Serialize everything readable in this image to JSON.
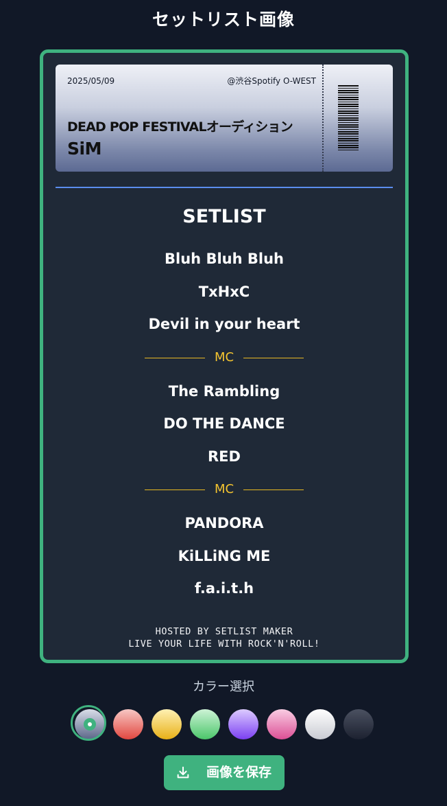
{
  "page": {
    "title": "セットリスト画像"
  },
  "ticket": {
    "date": "2025/05/09",
    "venue": "@渋谷Spotify O-WEST",
    "event": "DEAD POP FESTIVALオーディション",
    "artist": "SiM"
  },
  "setlist": {
    "heading": "SETLIST",
    "items": [
      {
        "type": "song",
        "text": "Bluh Bluh Bluh"
      },
      {
        "type": "song",
        "text": "TxHxC"
      },
      {
        "type": "song",
        "text": "Devil in your heart"
      },
      {
        "type": "mc",
        "text": "MC"
      },
      {
        "type": "song",
        "text": "The Rambling"
      },
      {
        "type": "song",
        "text": "DO THE DANCE"
      },
      {
        "type": "song",
        "text": "RED"
      },
      {
        "type": "mc",
        "text": "MC"
      },
      {
        "type": "song",
        "text": "PANDORA"
      },
      {
        "type": "song",
        "text": "KiLLiNG ME"
      },
      {
        "type": "song",
        "text": "f.a.i.t.h"
      }
    ],
    "footer_line1": "HOSTED BY SETLIST MAKER",
    "footer_line2": "LIVE YOUR LIFE WITH ROCK'N'ROLL!"
  },
  "color_picker": {
    "label": "カラー選択",
    "selected_index": 0,
    "swatches": [
      {
        "name": "slate",
        "gradient": [
          "#d9dde8",
          "#5b6689"
        ]
      },
      {
        "name": "red",
        "gradient": [
          "#f7c7c4",
          "#e2473f"
        ]
      },
      {
        "name": "yellow",
        "gradient": [
          "#fff1b3",
          "#e8b017"
        ]
      },
      {
        "name": "green",
        "gradient": [
          "#cdf3d6",
          "#4bc66a"
        ]
      },
      {
        "name": "purple",
        "gradient": [
          "#dccbff",
          "#7b3ff2"
        ]
      },
      {
        "name": "pink",
        "gradient": [
          "#f9cde3",
          "#dc4f95"
        ]
      },
      {
        "name": "white",
        "gradient": [
          "#ffffff",
          "#c9cbd3"
        ]
      },
      {
        "name": "black",
        "gradient": [
          "#4b5161",
          "#1c2130"
        ]
      }
    ]
  },
  "actions": {
    "save_label": "画像を保存",
    "save_icon": "download-icon"
  },
  "colors": {
    "accent": "#3fb27f",
    "mc": "#f4c430",
    "divider": "#5b8def",
    "background": "#111827",
    "card": "#1f2937"
  }
}
